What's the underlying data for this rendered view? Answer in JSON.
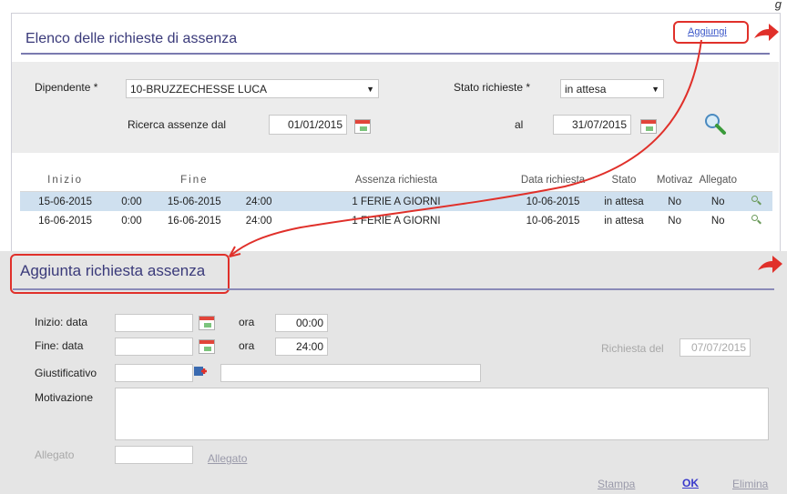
{
  "corner_text": "g",
  "list_panel": {
    "title": "Elenco delle richieste di assenza",
    "add_link": "Aggiungi",
    "employee_label": "Dipendente *",
    "employee_value": "10-BRUZZECHESSE LUCA",
    "status_label": "Stato richieste *",
    "status_value": "in attesa",
    "search_from_label": "Ricerca assenze dal",
    "date_from": "01/01/2015",
    "to_label": "al",
    "date_to": "31/07/2015",
    "columns": [
      "Inizio",
      "",
      "Fine",
      "",
      "Assenza richiesta",
      "Data richiesta",
      "Stato",
      "Motivaz",
      "Allegato",
      ""
    ],
    "rows": [
      {
        "start_date": "15-06-2015",
        "start_time": "0:00",
        "end_date": "15-06-2015",
        "end_time": "24:00",
        "type": "1 FERIE A GIORNI",
        "request_date": "10-06-2015",
        "status": "in attesa",
        "motiv": "No",
        "attach": "No",
        "selected": true
      },
      {
        "start_date": "16-06-2015",
        "start_time": "0:00",
        "end_date": "16-06-2015",
        "end_time": "24:00",
        "type": "1 FERIE A GIORNI",
        "request_date": "10-06-2015",
        "status": "in attesa",
        "motiv": "No",
        "attach": "No",
        "selected": false
      }
    ]
  },
  "form_panel": {
    "title": "Aggiunta richiesta assenza",
    "start_label": "Inizio: data",
    "end_label": "Fine:   data",
    "time_label": "ora",
    "start_time": "00:00",
    "end_time": "24:00",
    "justification_label": "Giustificativo",
    "reason_label": "Motivazione",
    "request_date_label": "Richiesta del",
    "request_date": "07/07/2015",
    "attachment_label": "Allegato",
    "attach_link": "Allegato",
    "print_link": "Stampa",
    "ok_link": "OK",
    "delete_link": "Elimina"
  },
  "colors": {
    "accent": "#3a3a7a",
    "annotation": "#e0302a",
    "selected_row": "#cfe0ef"
  }
}
